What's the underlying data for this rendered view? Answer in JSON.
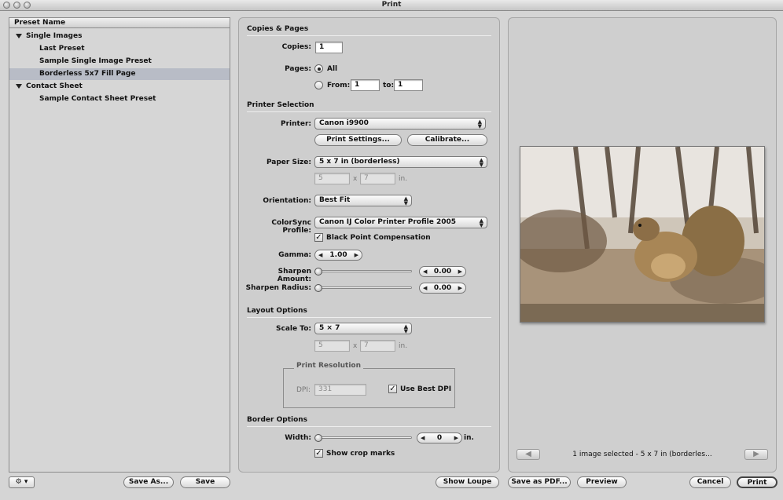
{
  "window": {
    "title": "Print"
  },
  "presets": {
    "header": "Preset Name",
    "items": [
      {
        "label": "Single Images",
        "group": true
      },
      {
        "label": "Last Preset",
        "group": false
      },
      {
        "label": "Sample Single Image Preset",
        "group": false
      },
      {
        "label": "Borderless 5x7 Fill Page",
        "group": false,
        "selected": true
      },
      {
        "label": "Contact Sheet",
        "group": true
      },
      {
        "label": "Sample Contact Sheet Preset",
        "group": false
      }
    ]
  },
  "bottom": {
    "gear": "⚙ ▾",
    "save_as": "Save As...",
    "save": "Save",
    "show_loupe": "Show Loupe",
    "save_pdf": "Save as PDF...",
    "preview": "Preview",
    "cancel": "Cancel",
    "print": "Print"
  },
  "copies_pages": {
    "title": "Copies & Pages",
    "copies_label": "Copies:",
    "copies_value": "1",
    "pages_label": "Pages:",
    "all_label": "All",
    "from_label": "From:",
    "from_value": "1",
    "to_label": "to:",
    "to_value": "1"
  },
  "printer_selection": {
    "title": "Printer Selection",
    "printer_label": "Printer:",
    "printer_value": "Canon i9900",
    "print_settings": "Print Settings...",
    "calibrate": "Calibrate...",
    "paper_label": "Paper Size:",
    "paper_value": "5 x 7 in (borderless)",
    "paper_w": "5",
    "paper_x": "x",
    "paper_h": "7",
    "paper_unit": "in.",
    "orientation_label": "Orientation:",
    "orientation_value": "Best Fit",
    "colorsync_label": "ColorSync Profile:",
    "colorsync_value": "Canon IJ Color Printer Profile 2005",
    "bpc_label": "Black Point Compensation",
    "gamma_label": "Gamma:",
    "gamma_value": "1.00",
    "sharpen_amount_label": "Sharpen Amount:",
    "sharpen_amount_value": "0.00",
    "sharpen_radius_label": "Sharpen Radius:",
    "sharpen_radius_value": "0.00"
  },
  "layout": {
    "title": "Layout Options",
    "scale_label": "Scale To:",
    "scale_value": "5 × 7",
    "scale_w": "5",
    "scale_x": "x",
    "scale_h": "7",
    "scale_unit": "in.",
    "resolution_title": "Print Resolution",
    "dpi_label": "DPI:",
    "dpi_value": "331",
    "best_dpi_label": "Use Best DPI"
  },
  "border": {
    "title": "Border Options",
    "width_label": "Width:",
    "width_value": "0",
    "width_unit": "in.",
    "crop_label": "Show crop marks"
  },
  "preview": {
    "status": "1 image selected - 5 x 7 in (borderles...",
    "prev_arrow": "◀",
    "next_arrow": "▶"
  },
  "colors": {
    "selection": "#b8bcc6",
    "window": "#d5d5d5"
  }
}
